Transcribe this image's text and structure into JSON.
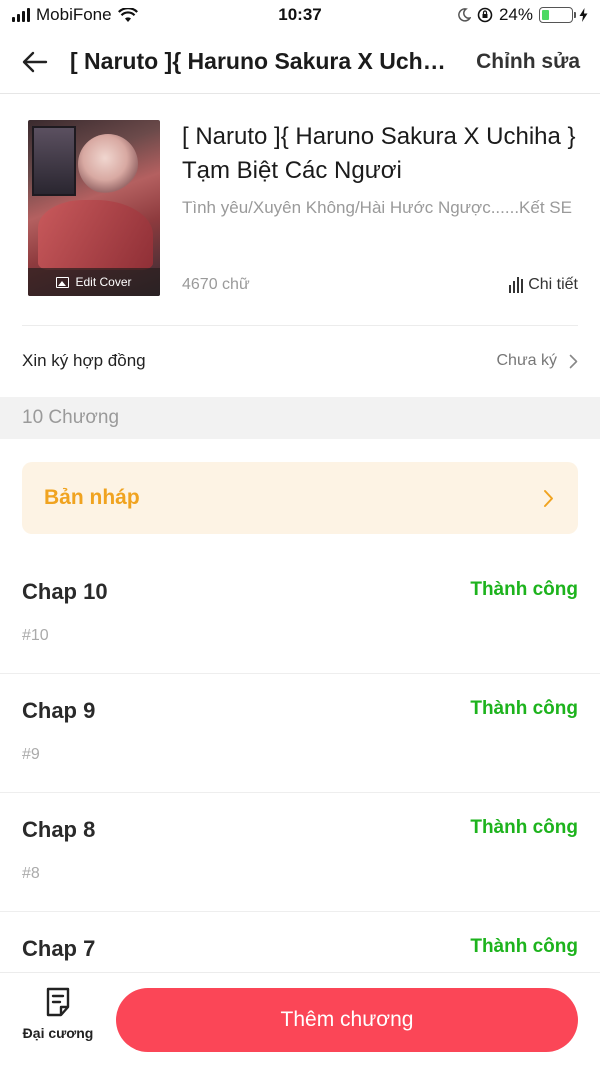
{
  "status_bar": {
    "carrier": "MobiFone",
    "time": "10:37",
    "battery_percent": "24%",
    "battery_level": 0.24,
    "icons": [
      "signal-icon",
      "wifi-icon",
      "moon-icon",
      "orientation-lock-icon",
      "battery-icon",
      "charging-icon"
    ]
  },
  "nav": {
    "title": "[ Naruto ]{ Haruno Sakura X Uchiha } Tạm Biệt Các Ngươi",
    "edit_label": "Chỉnh sửa"
  },
  "book": {
    "title": "[ Naruto ]{ Haruno Sakura X Uchiha } Tạm Biệt Các Ngươi",
    "genre": "Tình yêu/Xuyên Không/Hài Hước Ngược......Kết SE",
    "word_count": "4670 chữ",
    "detail_label": "Chi tiết",
    "edit_cover_label": "Edit Cover"
  },
  "contract": {
    "label": "Xin ký hợp đồng",
    "status": "Chưa ký"
  },
  "chapters_header": "10 Chương",
  "draft": {
    "label": "Bản nháp"
  },
  "chapters": [
    {
      "name": "Chap 10",
      "number": "#10",
      "status": "Thành công"
    },
    {
      "name": "Chap 9",
      "number": "#9",
      "status": "Thành công"
    },
    {
      "name": "Chap 8",
      "number": "#8",
      "status": "Thành công"
    },
    {
      "name": "Chap 7",
      "number": "",
      "status": "Thành công"
    }
  ],
  "bottom": {
    "outline_label": "Đại cương",
    "add_chapter_label": "Thêm chương"
  },
  "colors": {
    "accent_red": "#fb4657",
    "success_green": "#1db31d",
    "draft_orange": "#f0a320",
    "draft_bg": "#fdf3e4"
  }
}
